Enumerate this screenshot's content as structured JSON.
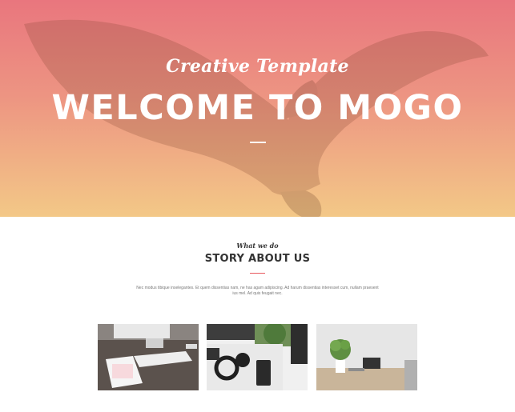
{
  "hero": {
    "script": "Creative Template",
    "title": "WELCOME TO MOGO",
    "background_colors": [
      "#e9767e",
      "#f3c887"
    ]
  },
  "section": {
    "kicker": "What we do",
    "title": "STORY ABOUT US",
    "accent": "#e7595e",
    "text": "Nec modus tibique inselegantes. Et quem dissentias nam, ne has agam adipiscing. Ad harum dissentias interesset cum, nullam praesent ius mel. Ad quis feugait nec."
  },
  "photos": [
    {
      "name": "desk-computer-tablet"
    },
    {
      "name": "desk-headphones-phone"
    },
    {
      "name": "desk-plant-table"
    }
  ]
}
